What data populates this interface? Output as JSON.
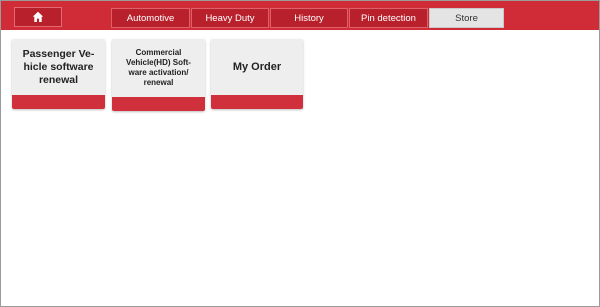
{
  "topbar": {
    "home_icon": "home-icon",
    "tabs": [
      {
        "label": "Automotive",
        "active": false
      },
      {
        "label": "Heavy Duty",
        "active": false
      },
      {
        "label": "History",
        "active": false
      },
      {
        "label": "Pin detection",
        "active": false
      },
      {
        "label": "Store",
        "active": true
      }
    ]
  },
  "tiles": [
    {
      "label": "Passenger Ve-\nhicle software\nrenewal"
    },
    {
      "label": "Commercial\nVehicle(HD) Soft-\nware activation/\nrenewal"
    },
    {
      "label": "My Order"
    }
  ],
  "colors": {
    "accent": "#cf2c38",
    "tab_dark": "#b8212c",
    "tab_active": "#e4e4e4",
    "tile_bg": "#eeeeee"
  }
}
